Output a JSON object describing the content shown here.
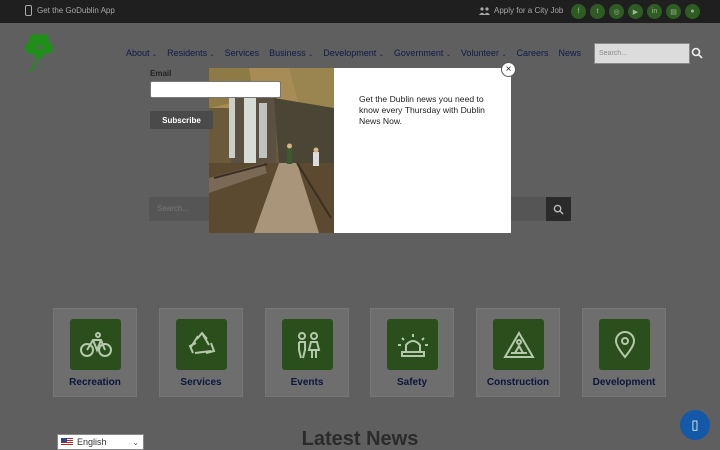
{
  "topbar": {
    "app_link": "Get the GoDublin App",
    "job_link": "Apply for a City Job",
    "social_icons": [
      "facebook-icon",
      "twitter-icon",
      "instagram-icon",
      "youtube-icon",
      "linkedin-icon",
      "news-icon",
      "pin-icon"
    ]
  },
  "nav": {
    "items": [
      {
        "label": "About",
        "dropdown": true
      },
      {
        "label": "Residents",
        "dropdown": true
      },
      {
        "label": "Services",
        "dropdown": false
      },
      {
        "label": "Business",
        "dropdown": true
      },
      {
        "label": "Development",
        "dropdown": true
      },
      {
        "label": "Government",
        "dropdown": true
      },
      {
        "label": "Volunteer",
        "dropdown": true
      },
      {
        "label": "Careers",
        "dropdown": false
      },
      {
        "label": "News",
        "dropdown": false
      }
    ],
    "search_placeholder": "Search..."
  },
  "hero": {
    "search_placeholder": "Search..."
  },
  "quick_links": [
    {
      "label": "Recreation",
      "icon": "bicycle-icon"
    },
    {
      "label": "Services",
      "icon": "recycle-icon"
    },
    {
      "label": "Events",
      "icon": "people-icon"
    },
    {
      "label": "Safety",
      "icon": "siren-icon"
    },
    {
      "label": "Construction",
      "icon": "construction-sign-icon"
    },
    {
      "label": "Development",
      "icon": "map-pin-icon"
    }
  ],
  "latest_news": "Latest News",
  "language": "English",
  "modal": {
    "message": "Get the Dublin news you need to know every Thursday with Dublin News Now.",
    "email_label": "Email",
    "subscribe_label": "Subscribe",
    "close_label": "×"
  },
  "colors": {
    "brand_green": "#2a4f1c",
    "nav_text": "#0f1a4a",
    "chat_blue": "#1359a8"
  }
}
